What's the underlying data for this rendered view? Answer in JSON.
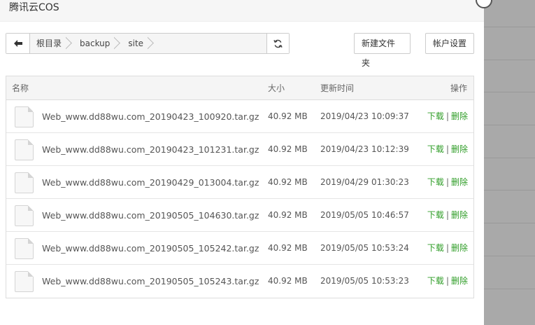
{
  "dialog": {
    "title": "腾讯云COS"
  },
  "breadcrumb": {
    "back_icon": "arrow-left-icon",
    "items": [
      "根目录",
      "backup",
      "site"
    ],
    "refresh_icon": "refresh-icon"
  },
  "toolbar": {
    "new_folder_label": "新建文件夹",
    "account_settings_label": "帐户设置"
  },
  "table": {
    "headers": {
      "name": "名称",
      "size": "大小",
      "time": "更新时间",
      "ops": "操作"
    },
    "rows": [
      {
        "name": "Web_www.dd88wu.com_20190423_100920.tar.gz",
        "size": "40.92 MB",
        "time": "2019/04/23 10:09:37",
        "download": "下载",
        "sep": "|",
        "delete": "删除"
      },
      {
        "name": "Web_www.dd88wu.com_20190423_101231.tar.gz",
        "size": "40.92 MB",
        "time": "2019/04/23 10:12:39",
        "download": "下载",
        "sep": "|",
        "delete": "删除"
      },
      {
        "name": "Web_www.dd88wu.com_20190429_013004.tar.gz",
        "size": "40.92 MB",
        "time": "2019/04/29 01:30:23",
        "download": "下载",
        "sep": "|",
        "delete": "删除"
      },
      {
        "name": "Web_www.dd88wu.com_20190505_104630.tar.gz",
        "size": "40.92 MB",
        "time": "2019/05/05 10:46:57",
        "download": "下载",
        "sep": "|",
        "delete": "删除"
      },
      {
        "name": "Web_www.dd88wu.com_20190505_105242.tar.gz",
        "size": "40.92 MB",
        "time": "2019/05/05 10:53:24",
        "download": "下载",
        "sep": "|",
        "delete": "删除"
      },
      {
        "name": "Web_www.dd88wu.com_20190505_105243.tar.gz",
        "size": "40.92 MB",
        "time": "2019/05/05 10:53:23",
        "download": "下载",
        "sep": "|",
        "delete": "删除"
      }
    ]
  },
  "colors": {
    "link": "#2f9d27",
    "overlay": "#8c8c8c"
  }
}
